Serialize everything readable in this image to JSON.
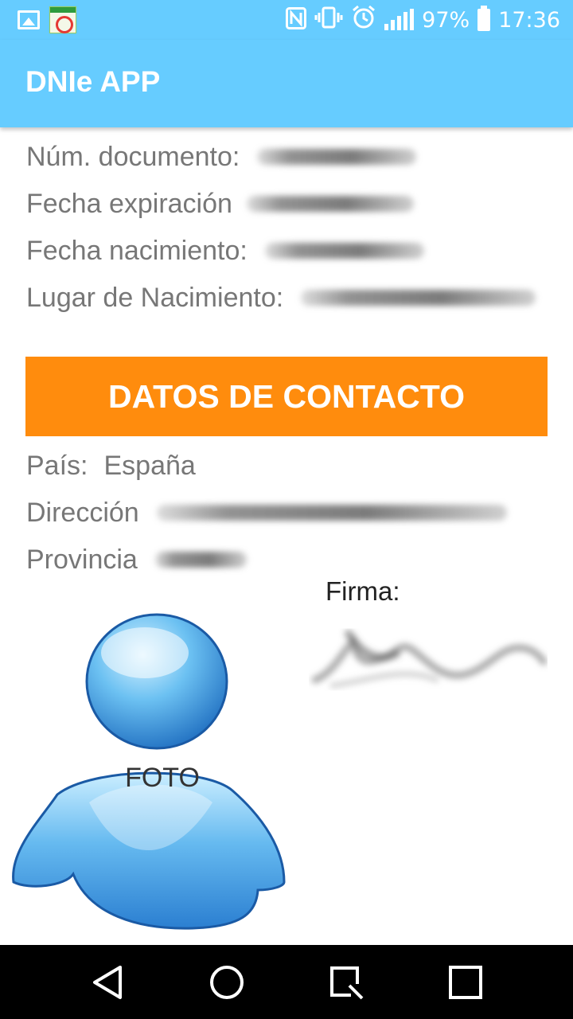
{
  "status_bar": {
    "battery_text": "97%",
    "time": "17:36",
    "icons": [
      "gallery-icon",
      "app-thumbnail-icon",
      "nfc-icon",
      "vibrate-icon",
      "alarm-icon",
      "signal-icon",
      "battery-icon"
    ]
  },
  "app_bar": {
    "title": "DNIe APP",
    "background_color": "#66ccff"
  },
  "personal_data": [
    {
      "label": "Núm. documento:"
    },
    {
      "label": "Fecha expiración"
    },
    {
      "label": "Fecha nacimiento:"
    },
    {
      "label": "Lugar de Nacimiento:"
    }
  ],
  "contact_section": {
    "header": "DATOS DE CONTACTO",
    "header_color": "#ff8c0d",
    "country_label": "País:",
    "country_value": "España",
    "address_label": "Dirección",
    "province_label": "Provincia"
  },
  "signature": {
    "label": "Firma:"
  },
  "photo": {
    "label": "FOTO"
  },
  "nav_bar": {
    "icons": [
      "back-icon",
      "home-icon",
      "recents-icon",
      "overview-icon"
    ]
  }
}
